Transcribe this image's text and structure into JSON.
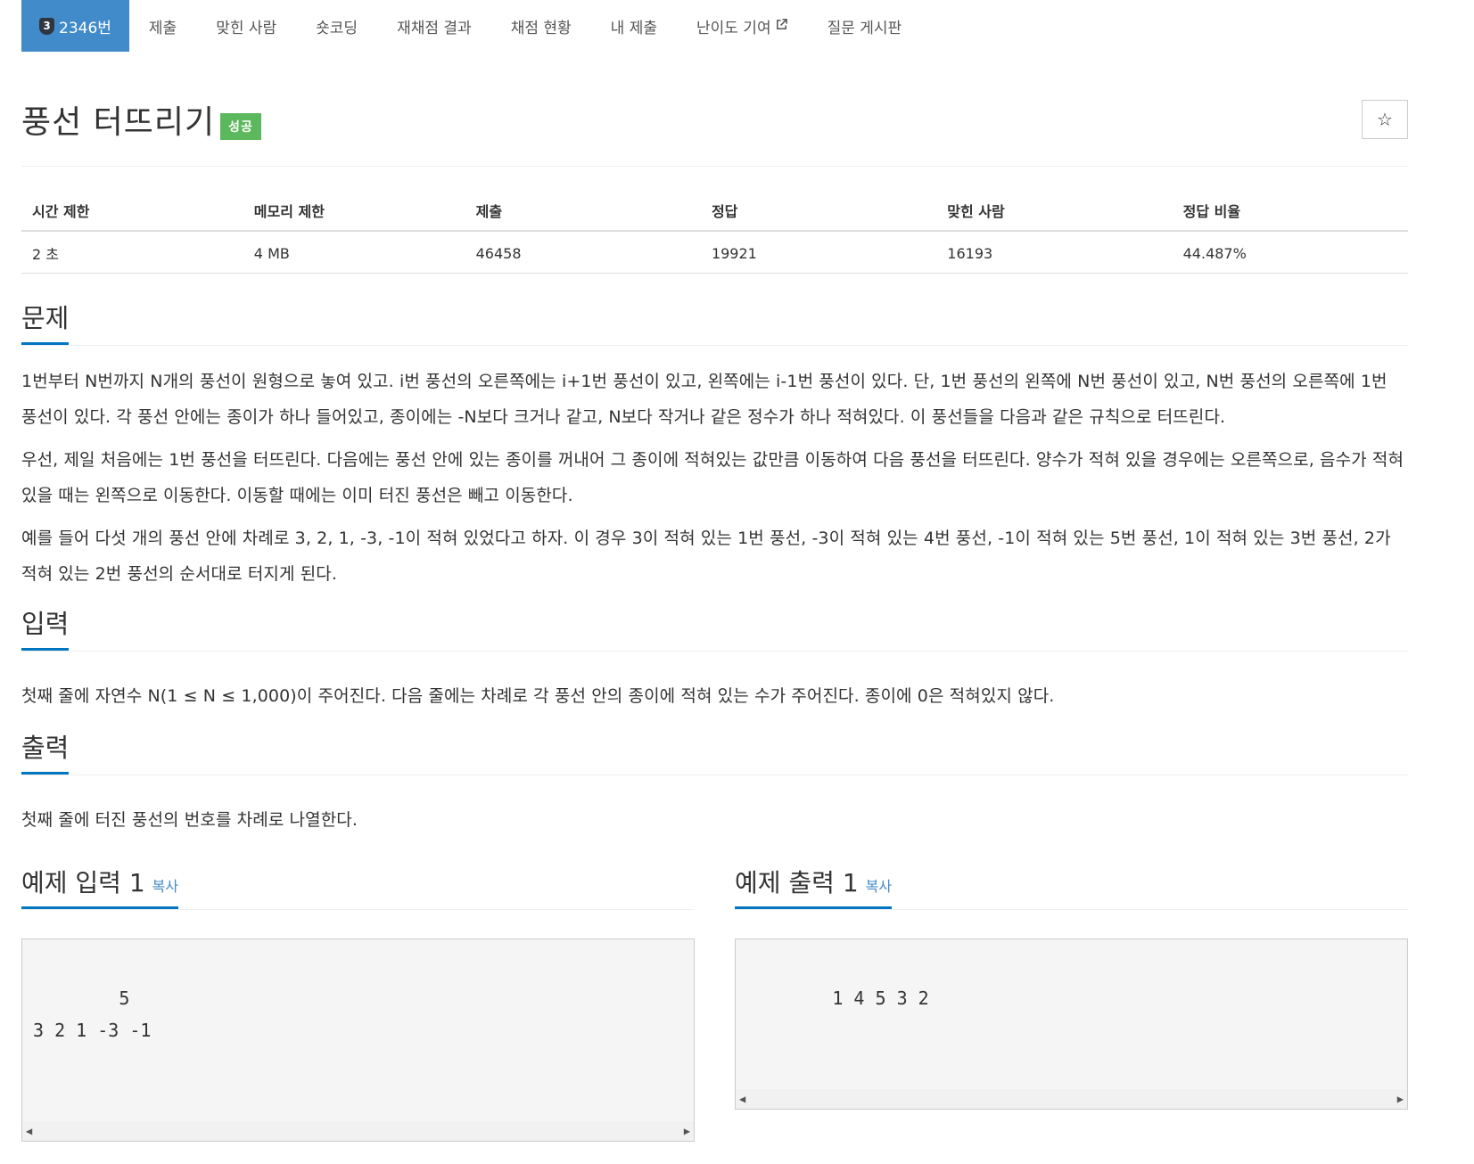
{
  "nav": {
    "problem_tab": {
      "tier": "3",
      "label": "2346번"
    },
    "tabs": [
      {
        "label": "제출"
      },
      {
        "label": "맞힌 사람"
      },
      {
        "label": "숏코딩"
      },
      {
        "label": "재채점 결과"
      },
      {
        "label": "채점 현황"
      },
      {
        "label": "내 제출"
      },
      {
        "label": "난이도 기여"
      },
      {
        "label": "질문 게시판"
      }
    ],
    "external_icon": "external-link-icon"
  },
  "problem": {
    "title": "풍선 터뜨리기",
    "badge": "성공",
    "star_icon": "☆"
  },
  "info": {
    "headers": [
      "시간 제한",
      "메모리 제한",
      "제출",
      "정답",
      "맞힌 사람",
      "정답 비율"
    ],
    "values": [
      "2 초",
      "4 MB",
      "46458",
      "19921",
      "16193",
      "44.487%"
    ]
  },
  "sections": {
    "description": {
      "heading": "문제",
      "paragraphs": [
        "1번부터 N번까지 N개의 풍선이 원형으로 놓여 있고. i번 풍선의 오른쪽에는 i+1번 풍선이 있고, 왼쪽에는 i-1번 풍선이 있다. 단, 1번 풍선의 왼쪽에 N번 풍선이 있고, N번 풍선의 오른쪽에 1번 풍선이 있다. 각 풍선 안에는 종이가 하나 들어있고, 종이에는 -N보다 크거나 같고, N보다 작거나 같은 정수가 하나 적혀있다. 이 풍선들을 다음과 같은 규칙으로 터뜨린다.",
        "우선, 제일 처음에는 1번 풍선을 터뜨린다. 다음에는 풍선 안에 있는 종이를 꺼내어 그 종이에 적혀있는 값만큼 이동하여 다음 풍선을 터뜨린다. 양수가 적혀 있을 경우에는 오른쪽으로, 음수가 적혀 있을 때는 왼쪽으로 이동한다. 이동할 때에는 이미 터진 풍선은 빼고 이동한다.",
        "예를 들어 다섯 개의 풍선 안에 차례로 3, 2, 1, -3, -1이 적혀 있었다고 하자. 이 경우 3이 적혀 있는 1번 풍선, -3이 적혀 있는 4번 풍선, -1이 적혀 있는 5번 풍선, 1이 적혀 있는 3번 풍선, 2가 적혀 있는 2번 풍선의 순서대로 터지게 된다."
      ]
    },
    "input": {
      "heading": "입력",
      "text": "첫째 줄에 자연수 N(1 ≤ N ≤ 1,000)이 주어진다. 다음 줄에는 차례로 각 풍선 안의 종이에 적혀 있는 수가 주어진다. 종이에 0은 적혀있지 않다."
    },
    "output": {
      "heading": "출력",
      "text": "첫째 줄에 터진 풍선의 번호를 차례로 나열한다."
    }
  },
  "samples": {
    "input": {
      "heading": "예제 입력 1",
      "copy": "복사",
      "content": "5\n3 2 1 -3 -1"
    },
    "output": {
      "heading": "예제 출력 1",
      "copy": "복사",
      "content": "1 4 5 3 2"
    }
  }
}
